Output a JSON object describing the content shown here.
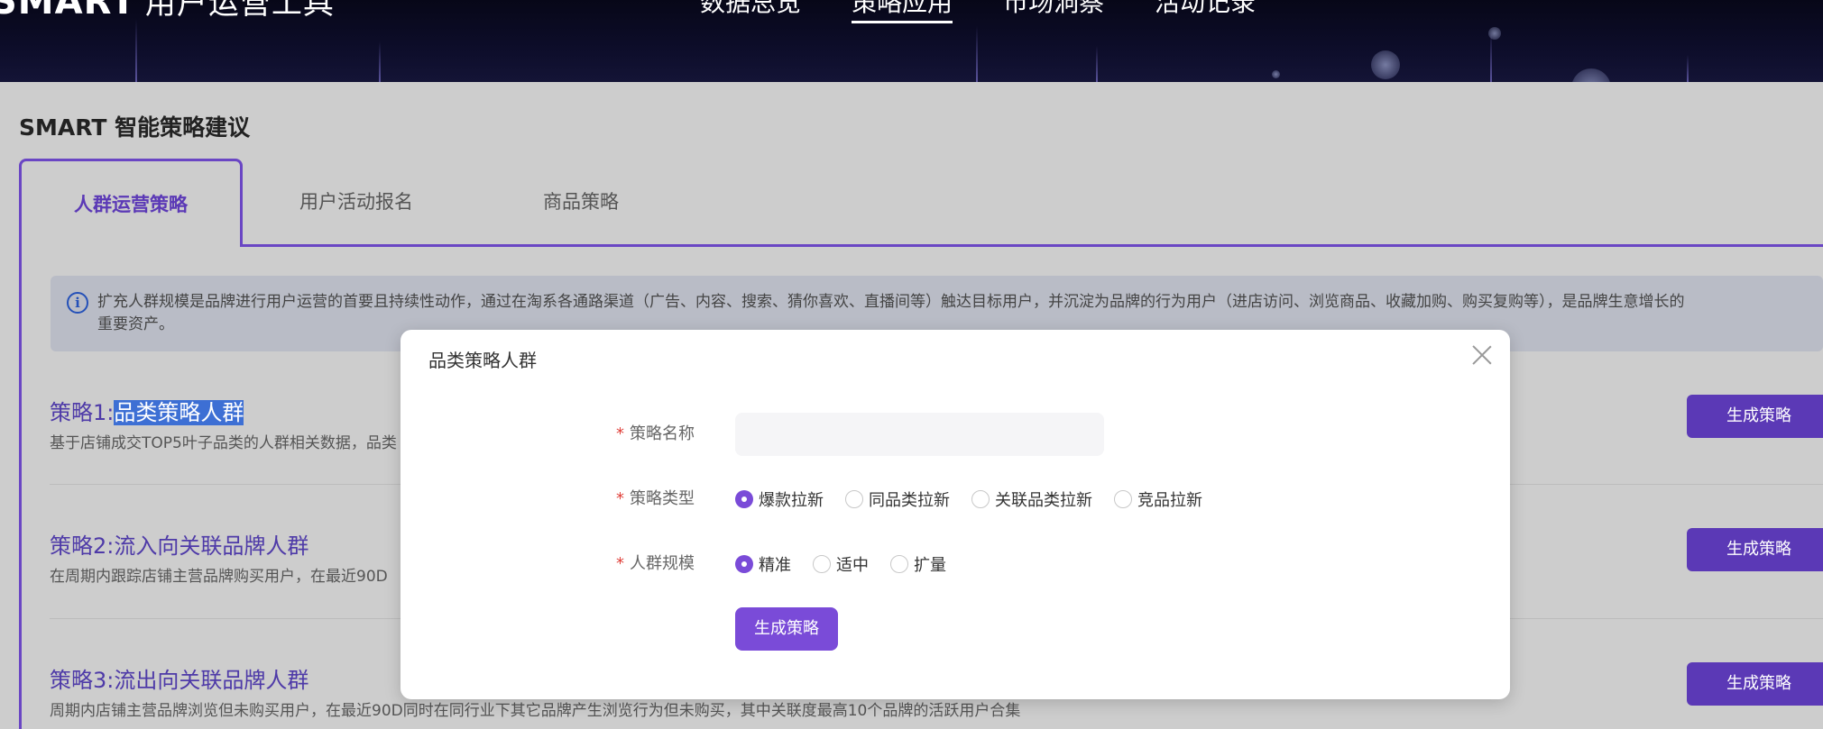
{
  "header": {
    "logo_text": "SMART",
    "logo_subtitle": "用户运营工具",
    "nav": [
      {
        "label": "数据总览",
        "active": false
      },
      {
        "label": "策略应用",
        "active": true
      },
      {
        "label": "市场洞察",
        "active": false
      },
      {
        "label": "活动记录",
        "active": false
      }
    ]
  },
  "page": {
    "title": "SMART 智能策略建议",
    "tabs": [
      {
        "label": "人群运营策略",
        "active": true
      },
      {
        "label": "用户活动报名",
        "active": false
      },
      {
        "label": "商品策略",
        "active": false
      }
    ],
    "info_banner": {
      "line1": "扩充人群规模是品牌进行用户运营的首要且持续性动作，通过在淘系各通路渠道（广告、内容、搜索、猜你喜欢、直播间等）触达目标用户，并沉淀为品牌的行为用户（进店访问、浏览商品、收藏加购、购买复购等），是品牌生意增长的",
      "line2": "重要资产。"
    },
    "strategies": [
      {
        "prefix": "策略1:",
        "name": "品类策略人群",
        "desc": "基于店铺成交TOP5叶子品类的人群相关数据，品类",
        "button": "生成策略"
      },
      {
        "prefix": "策略2:",
        "name": "流入向关联品牌人群",
        "desc": "在周期内跟踪店铺主营品牌购买用户，在最近90D",
        "button": "生成策略"
      },
      {
        "prefix": "策略3:",
        "name": "流出向关联品牌人群",
        "desc": "周期内店铺主营品牌浏览但未购买用户，在最近90D同时在同行业下其它品牌产生浏览行为但未购买，其中关联度最高10个品牌的活跃用户合集",
        "button": "生成策略"
      }
    ]
  },
  "modal": {
    "title": "品类策略人群",
    "required_mark": "*",
    "fields": {
      "name": {
        "label": "策略名称",
        "value": "",
        "placeholder": ""
      },
      "type": {
        "label": "策略类型",
        "options": [
          "爆款拉新",
          "同品类拉新",
          "关联品类拉新",
          "竞品拉新"
        ],
        "selected": 0
      },
      "scale": {
        "label": "人群规模",
        "options": [
          "精准",
          "适中",
          "扩量"
        ],
        "selected": 0
      }
    },
    "submit_label": "生成策略"
  },
  "colors": {
    "primary": "#5b39b6",
    "radio_checked": "#7a4bd8",
    "required": "#e0403a",
    "overlay_bg": "#cdcdcd"
  }
}
